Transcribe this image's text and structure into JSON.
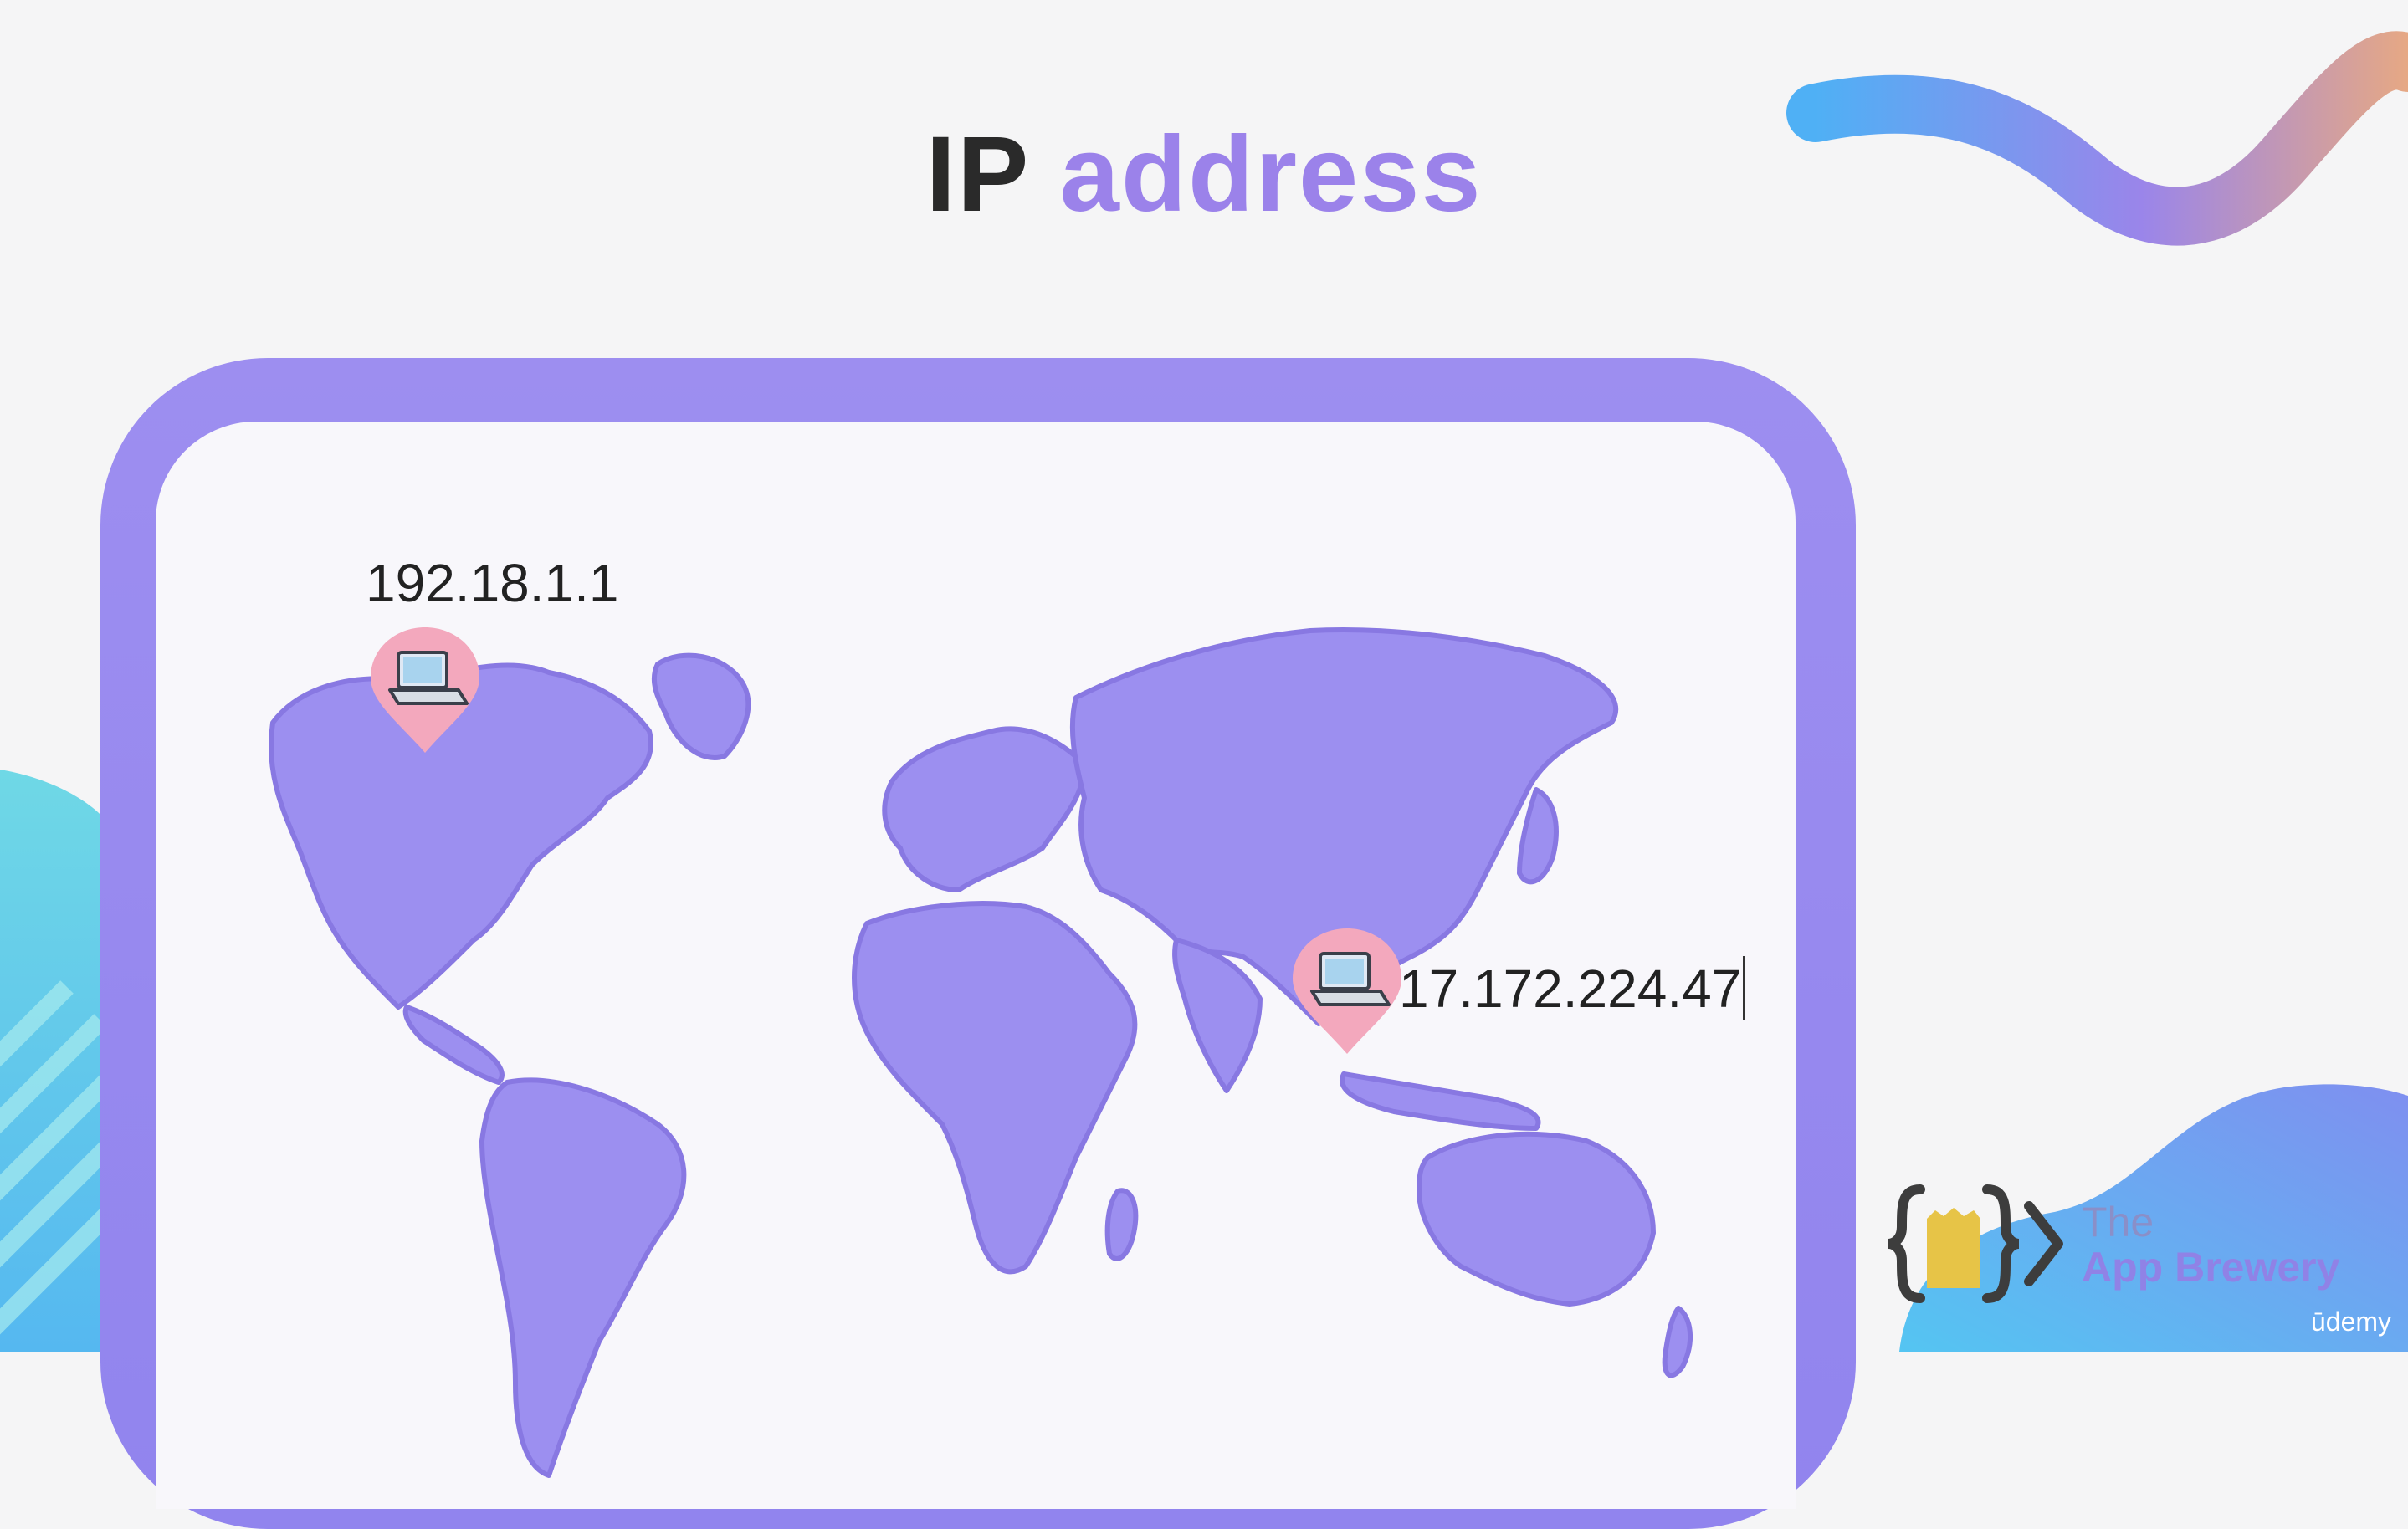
{
  "slide": {
    "title_part1": "IP",
    "title_part2": "address"
  },
  "devices": [
    {
      "ip": "192.18.1.1",
      "icon": "laptop-pin-icon",
      "region": "north-america"
    },
    {
      "ip": "17.172.224.47",
      "icon": "laptop-pin-icon",
      "region": "southeast-asia"
    }
  ],
  "branding": {
    "logo_the": "The",
    "logo_name": "App Brewery",
    "watermark": "ūdemy"
  },
  "colors": {
    "accent_purple": "#9b82ea",
    "map_purple": "#9c8ff0",
    "pin_pink": "#f2a6bd",
    "background": "#f5f5f6"
  }
}
